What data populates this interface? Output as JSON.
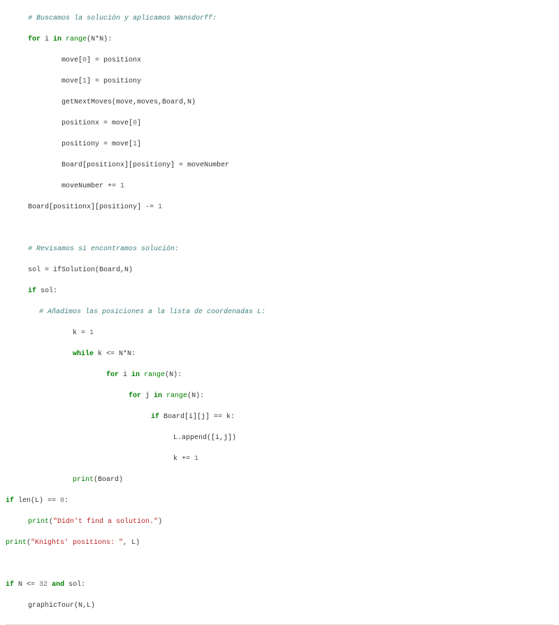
{
  "code": {
    "l1": "# Buscamos la solución y aplicamos Wansdorff:",
    "l2a": "for",
    "l2b": " i ",
    "l2c": "in",
    "l2d": " range",
    "l2e": "(N*N):",
    "l3a": "move[",
    "l3b": "0",
    "l3c": "] = positionx",
    "l4a": "move[",
    "l4b": "1",
    "l4c": "] = positiony",
    "l5": "getNextMoves(move,moves,Board,N)",
    "l6a": "positionx = move[",
    "l6b": "0",
    "l6c": "]",
    "l7a": "positiony = move[",
    "l7b": "1",
    "l7c": "]",
    "l8": "Board[positionx][positiony] = moveNumber",
    "l9a": "moveNumber += ",
    "l9b": "1",
    "l10a": "Board[positionx][positiony] -= ",
    "l10b": "1",
    "l11": "# Revisamos si encontramos solución:",
    "l12": "sol = ifSolution(Board,N)",
    "l13a": "if",
    "l13b": " sol:",
    "l14": "# Añadimos las posiciones a la lista de coordenadas L:",
    "l15a": "k = ",
    "l15b": "1",
    "l16a": "while",
    "l16b": " k <= N*N:",
    "l17a": "for",
    "l17b": " i ",
    "l17c": "in",
    "l17d": " range",
    "l17e": "(N):",
    "l18a": "for",
    "l18b": " j ",
    "l18c": "in",
    "l18d": " range",
    "l18e": "(N):",
    "l19a": "if",
    "l19b": " Board[i][j] == k:",
    "l20": "L.append([i,j])",
    "l21a": "k += ",
    "l21b": "1",
    "l22a": "print",
    "l22b": "(Board)",
    "l23a": "if",
    "l23b": " len(L) == ",
    "l23c": "0",
    "l23d": ":",
    "l24a": "print",
    "l24b": "(",
    "l24c": "\"Didn't find a solution.\"",
    "l24d": ")",
    "l25a": "print",
    "l25b": "(",
    "l25c": "\"Knights' positions: \"",
    "l25d": ", L)",
    "l26a": "if",
    "l26b": " N <= ",
    "l26c": "32",
    "l26d": " ",
    "l26e": "and",
    "l26f": " sol:",
    "l27": "graphicTour(N,L)"
  }
}
